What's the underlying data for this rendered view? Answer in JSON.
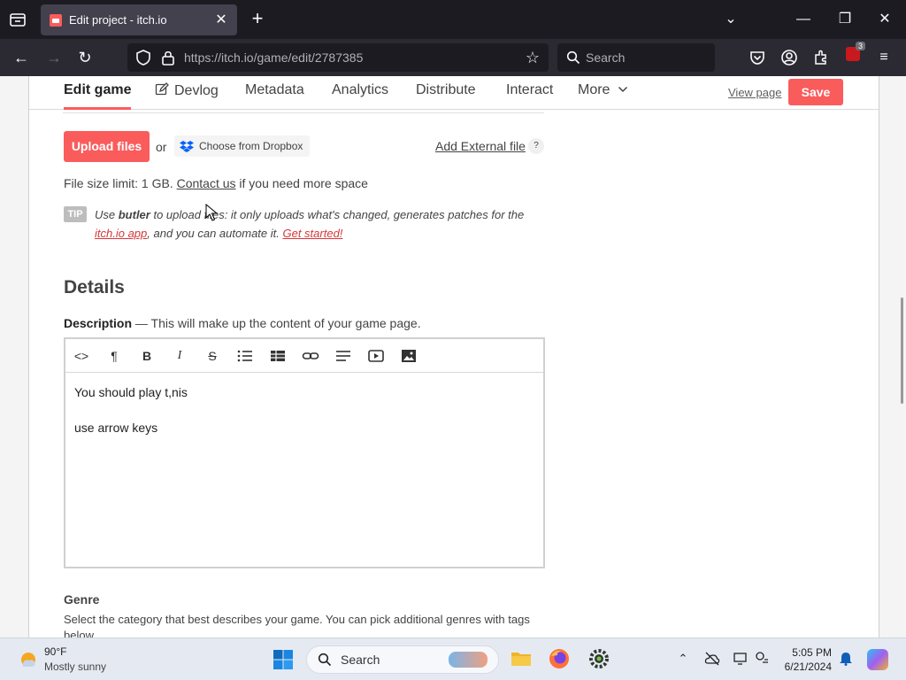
{
  "browser": {
    "tab_title": "Edit project - itch.io",
    "url": "https://itch.io/game/edit/2787385",
    "search_placeholder": "Search",
    "ext_badge_count": "3"
  },
  "edit_nav": {
    "tabs": [
      "Edit game",
      "Devlog",
      "Metadata",
      "Analytics",
      "Distribute",
      "Interact",
      "More"
    ],
    "view_page": "View page",
    "save": "Save"
  },
  "uploads": {
    "upload_button": "Upload files",
    "or": "or",
    "dropbox": "Choose from Dropbox",
    "external": "Add External file",
    "help": "?",
    "size_limit_prefix": "File size limit: 1 GB. ",
    "contact_link": "Contact us",
    "size_limit_suffix": " if you need more space",
    "tip_badge": "TIP",
    "tip_use": "Use ",
    "tip_butler": "butler",
    "tip_middle": " to upload files: it only uploads what's changed, generates patches for the ",
    "tip_app_link": "itch.io app",
    "tip_end": ", and you can automate it. ",
    "tip_started": "Get started!"
  },
  "details": {
    "heading": "Details",
    "desc_label": "Description",
    "desc_hint": " — This will make up the content of your game page.",
    "editor_lines": [
      "You should play t,nis",
      "use arrow keys"
    ],
    "genre_heading": "Genre",
    "genre_desc": "Select the category that best describes your game. You can pick additional genres with tags below"
  },
  "taskbar": {
    "temp": "90°F",
    "weather": "Mostly sunny",
    "search": "Search",
    "time": "5:05 PM",
    "date": "6/21/2024"
  },
  "colors": {
    "accent": "#fa5c5c",
    "browser_dark": "#1c1b22",
    "browser_mid": "#2b2a33"
  },
  "icons": [
    "tab-list-icon",
    "close-icon",
    "plus-icon",
    "chevron-down-icon",
    "minimize-icon",
    "restore-icon",
    "back-icon",
    "forward-icon",
    "reload-icon",
    "shield-icon",
    "lock-icon",
    "star-icon",
    "search-icon",
    "pocket-icon",
    "account-icon",
    "extensions-icon",
    "menu-icon",
    "pencil-icon",
    "dropbox-icon",
    "code-icon",
    "paragraph-icon",
    "bold-icon",
    "italic-icon",
    "strikethrough-icon",
    "bullet-list-icon",
    "table-icon",
    "link-icon",
    "align-icon",
    "video-icon",
    "image-icon"
  ]
}
